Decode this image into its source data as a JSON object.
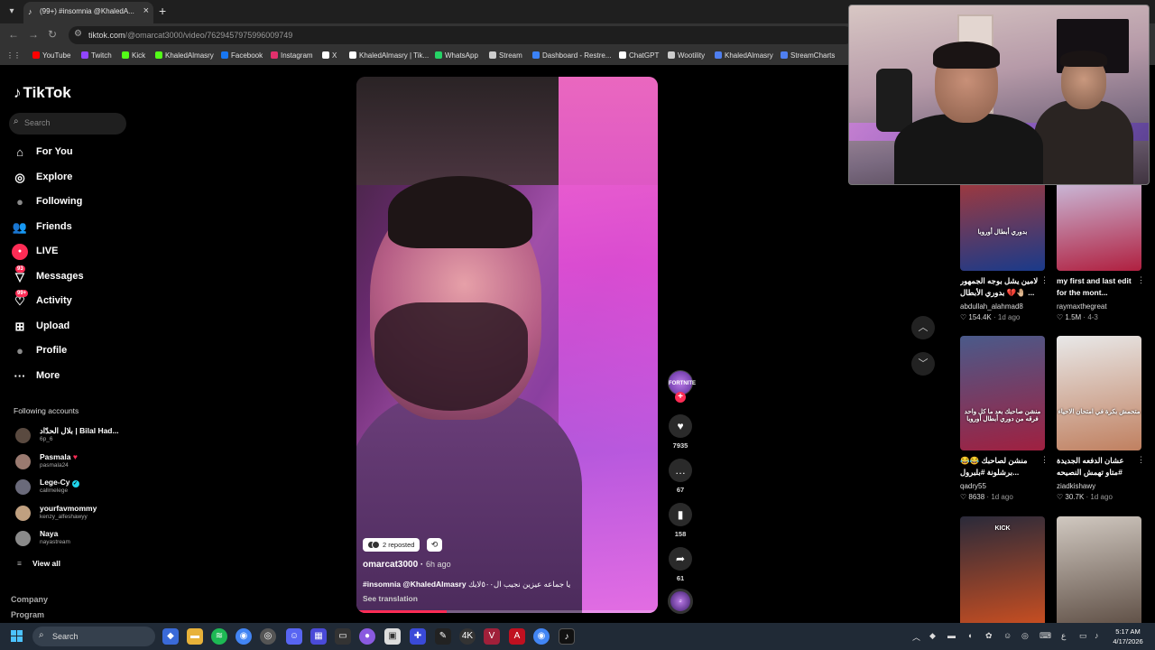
{
  "browser": {
    "tab_title": "(99+) #insomnia @KhaledA...",
    "url_host": "tiktok.com",
    "url_path": "/@omarcat3000/video/7629457975996009749",
    "bookmarks": [
      {
        "label": "YouTube",
        "color": "#ff0000"
      },
      {
        "label": "Twitch",
        "color": "#9146ff"
      },
      {
        "label": "Kick",
        "color": "#53fc18"
      },
      {
        "label": "KhaledAlmasry",
        "color": "#53fc18"
      },
      {
        "label": "Facebook",
        "color": "#1877f2"
      },
      {
        "label": "Instagram",
        "color": "#e1306c"
      },
      {
        "label": "X",
        "color": "#ffffff"
      },
      {
        "label": "KhaledAlmasry | Tik...",
        "color": "#ffffff"
      },
      {
        "label": "WhatsApp",
        "color": "#25d366"
      },
      {
        "label": "Stream",
        "color": "#cccccc"
      },
      {
        "label": "Dashboard - Restre...",
        "color": "#3b82f6"
      },
      {
        "label": "ChatGPT",
        "color": "#ffffff"
      },
      {
        "label": "Wootility",
        "color": "#cccccc"
      },
      {
        "label": "KhaledAlmasry",
        "color": "#4f7ff0"
      },
      {
        "label": "StreamCharts",
        "color": "#4f7ff0"
      }
    ]
  },
  "sidebar": {
    "logo": "TikTok",
    "search_placeholder": "Search",
    "nav": [
      {
        "label": "For You",
        "icon": "home-icon"
      },
      {
        "label": "Explore",
        "icon": "compass-icon"
      },
      {
        "label": "Following",
        "icon": "following-icon"
      },
      {
        "label": "Friends",
        "icon": "friends-icon"
      },
      {
        "label": "LIVE",
        "icon": "live-icon"
      },
      {
        "label": "Messages",
        "icon": "messages-icon",
        "badge": "93"
      },
      {
        "label": "Activity",
        "icon": "activity-icon",
        "badge": "99+"
      },
      {
        "label": "Upload",
        "icon": "upload-icon"
      },
      {
        "label": "Profile",
        "icon": "profile-icon"
      },
      {
        "label": "More",
        "icon": "more-icon"
      }
    ],
    "following_title": "Following accounts",
    "accounts": [
      {
        "name": "بلال الحدّاد | Bilal Had...",
        "username": "6p_6",
        "verified": false,
        "heart": false
      },
      {
        "name": "Pasmala",
        "username": "pasmala24",
        "verified": false,
        "heart": true
      },
      {
        "name": "Lege-Cy",
        "username": "callmelege",
        "verified": true,
        "heart": false
      },
      {
        "name": "yourfavmommy",
        "username": "kenzy_alfeshawyy",
        "verified": false,
        "heart": false
      },
      {
        "name": "Naya",
        "username": "nayastream",
        "verified": false,
        "heart": false
      }
    ],
    "view_all": "View all",
    "footer": [
      "Company",
      "Program"
    ]
  },
  "video": {
    "reposted": "2 reposted",
    "author": "omarcat3000",
    "ago": "6h ago",
    "caption_tags": "#insomnia @KhaledAlmasry",
    "caption_text": "يا جماعه عيزين نجيب ال٥٠٠لايك",
    "see_translation": "See translation",
    "progress": 0.3,
    "likes": "7935",
    "comments": "67",
    "saves": "158",
    "shares": "61",
    "avatar_label": "FORTNITE"
  },
  "feed": [
    {
      "title": "لامين يشل بوجه الجمهور 🤚🏼💔 بدوري الأبطال ...",
      "user": "abdullah_alahmad8",
      "likes": "154.4K",
      "date": "1d ago",
      "thumb_text": "بدوري أبطال أوروبا",
      "c1": "#c0392b",
      "c2": "#1a3a8a"
    },
    {
      "title": "my first and last edit for the mont...",
      "user": "raymaxthegreat",
      "likes": "1.5M",
      "date": "4-3",
      "thumb_text": "",
      "c1": "#d0e0ff",
      "c2": "#b02040"
    },
    {
      "title": "😂😂 منشن لصاحبك برشلونة #بلبرول...",
      "user": "qadry55",
      "likes": "8638",
      "date": "1d ago",
      "thumb_text": "منشن صاحبك بعد ما كل واحد فرقه من دوري أبطال أوروبا",
      "c1": "#4a5a8a",
      "c2": "#a02040"
    },
    {
      "title": "عشان الدفعه الجديدة #متاو تهمش النصيحه #fy...",
      "user": "ziadkishawy",
      "likes": "30.7K",
      "date": "1d ago",
      "thumb_text": "متحمش بكرة في امتحان الاحياء",
      "c1": "#e8e8e8",
      "c2": "#c08060"
    },
    {
      "title": "",
      "user": "",
      "likes": "",
      "date": "",
      "thumb_text": "KICK",
      "c1": "#2a2a3a",
      "c2": "#d05020"
    },
    {
      "title": "",
      "user": "",
      "likes": "",
      "date": "",
      "thumb_text": "",
      "c1": "#d0c8c0",
      "c2": "#5a4a40"
    }
  ],
  "taskbar": {
    "search": "Search",
    "lang": "ع",
    "time": "5:17 AM",
    "date": "4/17/2026"
  }
}
